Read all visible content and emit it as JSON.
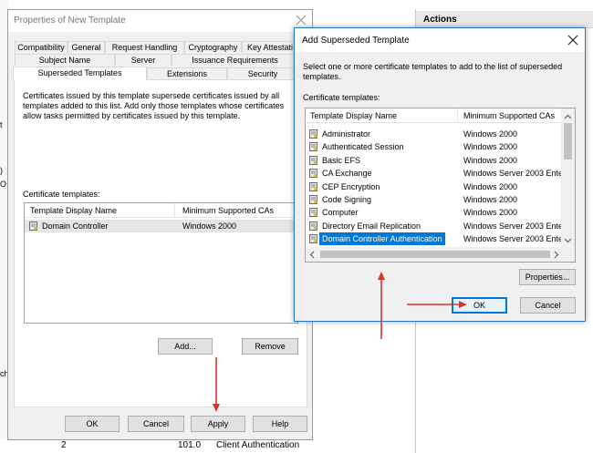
{
  "background": {
    "left_texts": [
      "t",
      ")",
      "O",
      "ch"
    ],
    "bottom_row": {
      "c1": "2",
      "c2": "101.0",
      "c3": "Client Authentication"
    },
    "actions_title": "Actions"
  },
  "props": {
    "title": "Properties of New Template",
    "tabs_row1": [
      "Compatibility",
      "General",
      "Request Handling",
      "Cryptography",
      "Key Attestati"
    ],
    "tabs_row2": [
      "Subject Name",
      "Server",
      "Issuance Requirements"
    ],
    "tabs_row3": [
      "Superseded Templates",
      "Extensions",
      "Security"
    ],
    "description": "Certificates issued by this template supersede certificates issued by all templates added to this list. Add only those templates whose certificates allow tasks permitted by certificates issued by this template.",
    "list_label": "Certificate templates:",
    "col1": "Template Display Name",
    "col2": "Minimum Supported CAs",
    "rows": [
      {
        "name": "Domain Controller",
        "ca": "Windows 2000"
      }
    ],
    "add_label": "Add...",
    "remove_label": "Remove",
    "ok_label": "OK",
    "cancel_label": "Cancel",
    "apply_label": "Apply",
    "help_label": "Help"
  },
  "dialog": {
    "title": "Add Superseded Template",
    "description": "Select one or more certificate templates to add to the list of superseded templates.",
    "list_label": "Certificate templates:",
    "col1": "Template Display Name",
    "col2": "Minimum Supported CAs",
    "rows": [
      {
        "name": "Administrator",
        "ca": "Windows 2000"
      },
      {
        "name": "Authenticated Session",
        "ca": "Windows 2000"
      },
      {
        "name": "Basic EFS",
        "ca": "Windows 2000"
      },
      {
        "name": "CA Exchange",
        "ca": "Windows Server 2003 Ente"
      },
      {
        "name": "CEP Encryption",
        "ca": "Windows 2000"
      },
      {
        "name": "Code Signing",
        "ca": "Windows 2000"
      },
      {
        "name": "Computer",
        "ca": "Windows 2000"
      },
      {
        "name": "Directory Email Replication",
        "ca": "Windows Server 2003 Ente"
      },
      {
        "name": "Domain Controller Authentication",
        "ca": "Windows Server 2003 Ente"
      }
    ],
    "selected_index": 8,
    "properties_label": "Properties...",
    "ok_label": "OK",
    "cancel_label": "Cancel"
  },
  "colors": {
    "annotation": "#d9342b",
    "selection": "#0078d7",
    "focus_border": "#0078d7"
  }
}
